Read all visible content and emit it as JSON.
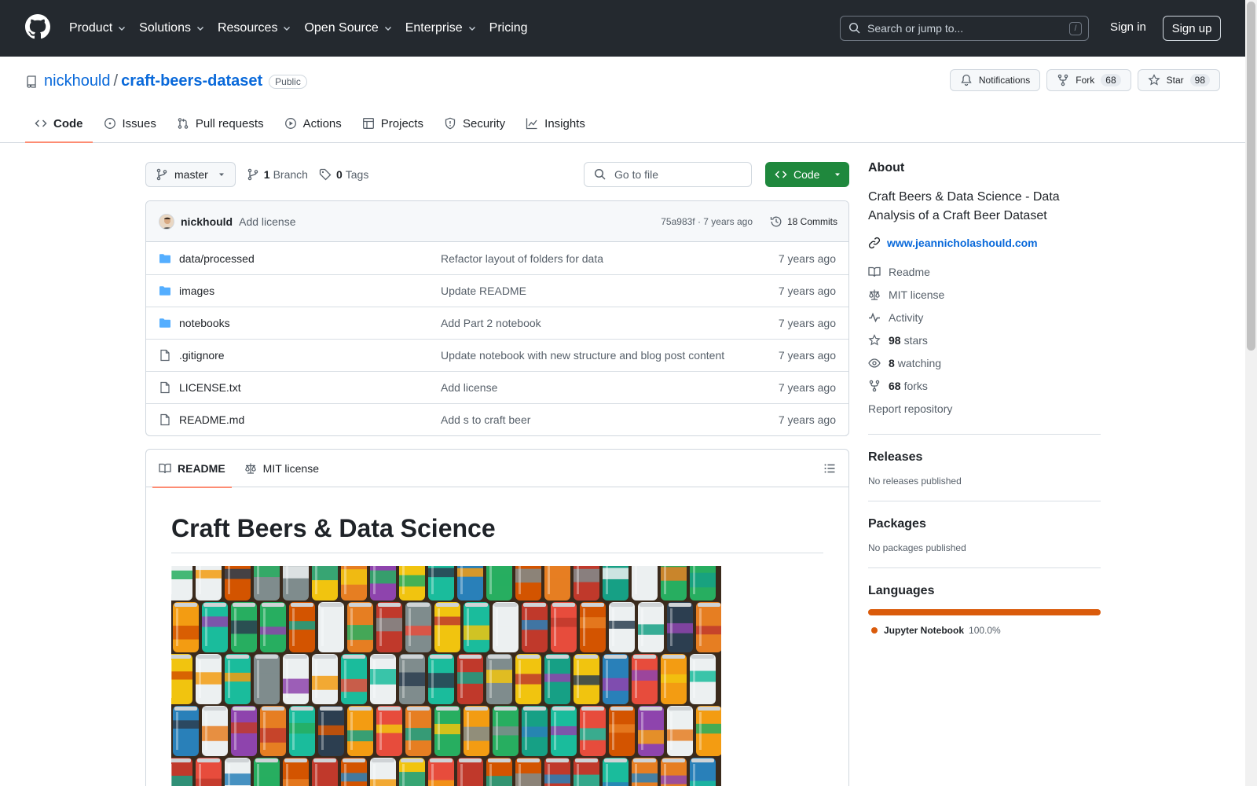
{
  "header": {
    "nav": [
      "Product",
      "Solutions",
      "Resources",
      "Open Source",
      "Enterprise",
      "Pricing"
    ],
    "search_placeholder": "Search or jump to...",
    "search_shortcut": "/",
    "signin": "Sign in",
    "signup": "Sign up"
  },
  "repo": {
    "owner": "nickhould",
    "separator": "/",
    "name": "craft-beers-dataset",
    "visibility": "Public",
    "notifications_label": "Notifications",
    "fork_label": "Fork",
    "fork_count": "68",
    "star_label": "Star",
    "star_count": "98"
  },
  "tabs": [
    "Code",
    "Issues",
    "Pull requests",
    "Actions",
    "Projects",
    "Security",
    "Insights"
  ],
  "toolbar": {
    "branch": "master",
    "branch_count": "1",
    "branch_label": "Branch",
    "tag_count": "0",
    "tag_label": "Tags",
    "goto_placeholder": "Go to file",
    "code_label": "Code"
  },
  "latest_commit": {
    "author": "nickhould",
    "message": "Add license",
    "hash_age": "75a983f · 7 years ago",
    "commits": "18 Commits"
  },
  "files": [
    {
      "name": "data/processed",
      "type": "folder",
      "commit": "Refactor layout of folders for data",
      "age": "7 years ago"
    },
    {
      "name": "images",
      "type": "folder",
      "commit": "Update README",
      "age": "7 years ago"
    },
    {
      "name": "notebooks",
      "type": "folder",
      "commit": "Add Part 2 notebook",
      "age": "7 years ago"
    },
    {
      "name": ".gitignore",
      "type": "file",
      "commit": "Update notebook with new structure and blog post content",
      "age": "7 years ago"
    },
    {
      "name": "LICENSE.txt",
      "type": "file",
      "commit": "Add license",
      "age": "7 years ago"
    },
    {
      "name": "README.md",
      "type": "file",
      "commit": "Add s to craft beer",
      "age": "7 years ago"
    }
  ],
  "readme": {
    "tab_readme": "README",
    "tab_license": "MIT license",
    "heading": "Craft Beers & Data Science"
  },
  "about": {
    "title": "About",
    "description": "Craft Beers & Data Science - Data Analysis of a Craft Beer Dataset",
    "website": "www.jeannicholashould.com",
    "readme": "Readme",
    "license": "MIT license",
    "activity": "Activity",
    "stars_count": "98",
    "stars_label": "stars",
    "watching_count": "8",
    "watching_label": "watching",
    "forks_count": "68",
    "forks_label": "forks",
    "report": "Report repository"
  },
  "releases": {
    "title": "Releases",
    "empty": "No releases published"
  },
  "packages": {
    "title": "Packages",
    "empty": "No packages published"
  },
  "languages": {
    "title": "Languages",
    "items": [
      {
        "name": "Jupyter Notebook",
        "pct": "100.0%",
        "color": "#da5b0b"
      }
    ]
  },
  "colors": {
    "header_bg": "#24292f",
    "link": "#0969da",
    "green": "#1f883d",
    "tab_underline": "#fd8c73"
  }
}
